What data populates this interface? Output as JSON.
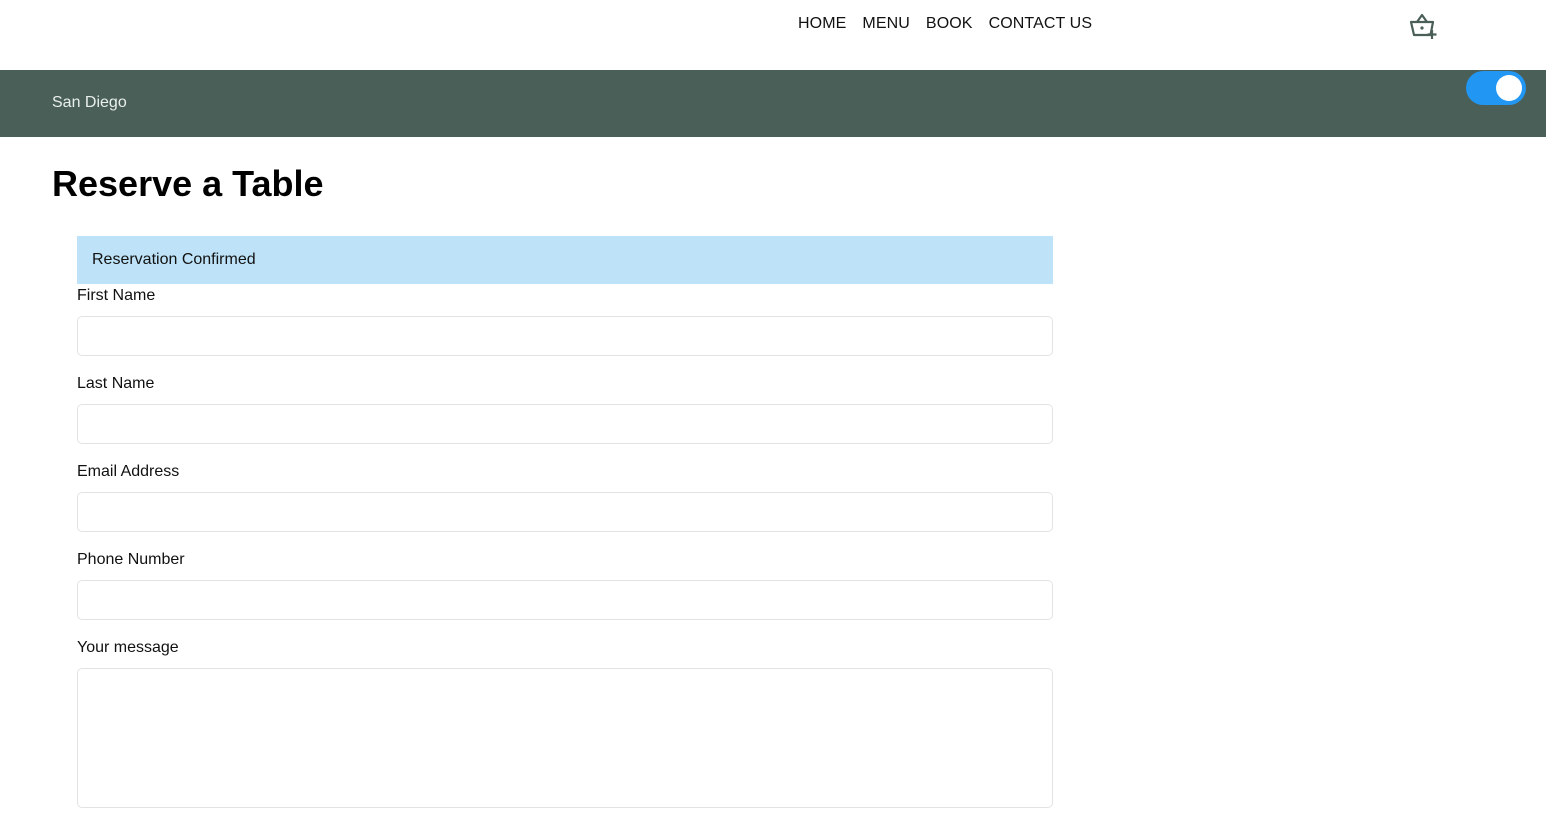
{
  "nav": {
    "links": [
      "HOME",
      "MENU",
      "BOOK",
      "CONTACT US"
    ],
    "cart_icon": "basket-plus-icon"
  },
  "banner": {
    "city": "San Diego",
    "toggle_on": true,
    "toggle_color": "#2196f3",
    "background_color": "#4a5f57"
  },
  "page": {
    "title": "Reserve a Table"
  },
  "form": {
    "alert": "Reservation Confirmed",
    "alert_color": "#bee3f8",
    "fields": [
      {
        "label": "First Name",
        "value": ""
      },
      {
        "label": "Last Name",
        "value": ""
      },
      {
        "label": "Email Address",
        "value": ""
      },
      {
        "label": "Phone Number",
        "value": ""
      }
    ],
    "message_label": "Your message",
    "message_value": ""
  }
}
